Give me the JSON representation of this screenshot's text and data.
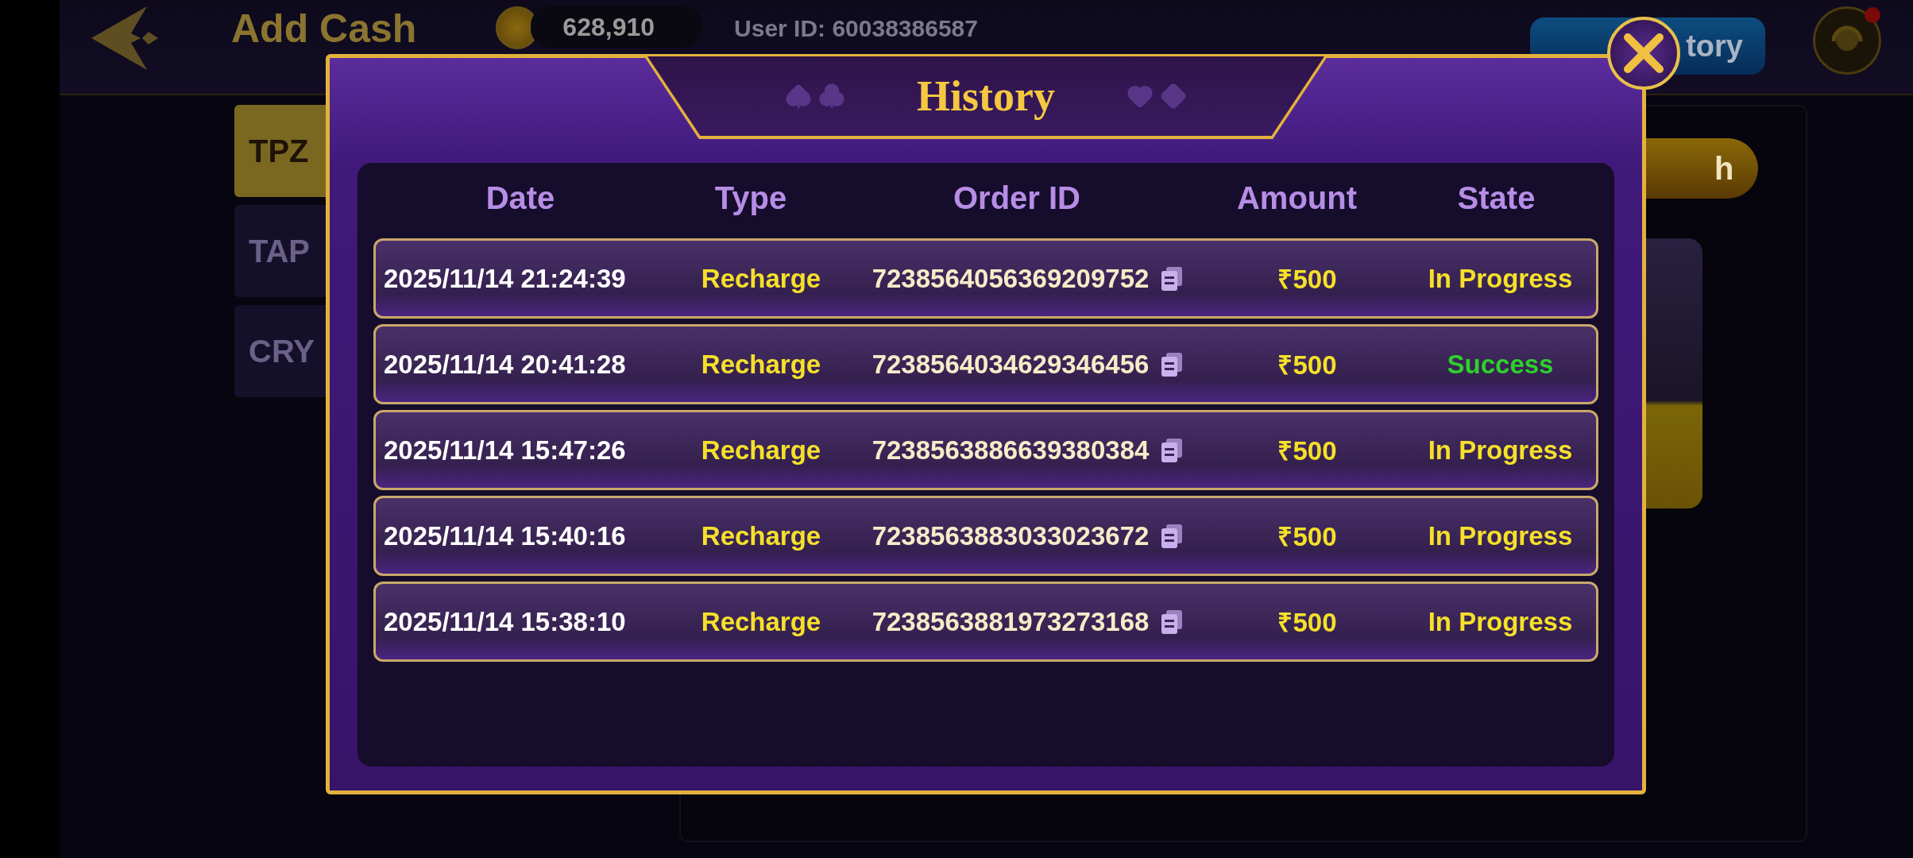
{
  "top_bar": {
    "title": "Add Cash",
    "balance": "628,910",
    "user_id": "User ID: 60038386587",
    "history_button": "tory"
  },
  "side_tabs": [
    {
      "label": "TPZ",
      "selected": true
    },
    {
      "label": "TAP",
      "selected": false
    },
    {
      "label": "CRY",
      "selected": false
    }
  ],
  "right_panel": {
    "button_fragment": "h"
  },
  "dialog": {
    "title": "History",
    "columns": [
      "Date",
      "Type",
      "Order ID",
      "Amount",
      "State"
    ],
    "rows": [
      {
        "date": "2025/11/14 21:24:39",
        "type": "Recharge",
        "order_id": "7238564056369209752",
        "amount": "₹500",
        "state": "In Progress",
        "kind": "in_progress"
      },
      {
        "date": "2025/11/14 20:41:28",
        "type": "Recharge",
        "order_id": "7238564034629346456",
        "amount": "₹500",
        "state": "Success",
        "kind": "success"
      },
      {
        "date": "2025/11/14 15:47:26",
        "type": "Recharge",
        "order_id": "7238563886639380384",
        "amount": "₹500",
        "state": "In Progress",
        "kind": "in_progress"
      },
      {
        "date": "2025/11/14 15:40:16",
        "type": "Recharge",
        "order_id": "7238563883033023672",
        "amount": "₹500",
        "state": "In Progress",
        "kind": "in_progress"
      },
      {
        "date": "2025/11/14 15:38:10",
        "type": "Recharge",
        "order_id": "7238563881973273168",
        "amount": "₹500",
        "state": "In Progress",
        "kind": "in_progress"
      }
    ]
  }
}
